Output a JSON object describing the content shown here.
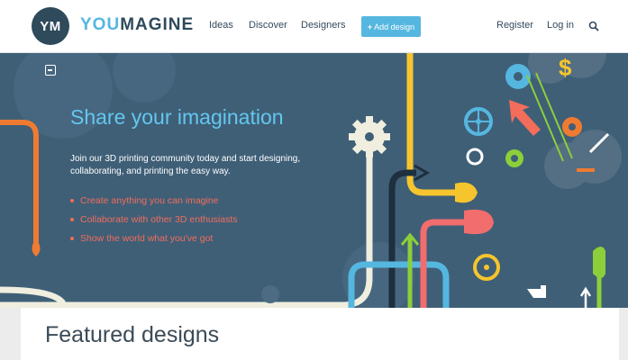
{
  "header": {
    "logo_badge": "YM",
    "logo_you": "YOU",
    "logo_magine": "MAGINE",
    "nav": [
      "Ideas",
      "Discover",
      "Designers"
    ],
    "add_button_plus": "+",
    "add_button_label": "Add design",
    "register": "Register",
    "login": "Log in",
    "search_icon": "search-icon"
  },
  "hero": {
    "title": "Share your imagination",
    "subtitle": "Join our 3D printing community today and start designing, collaborating, and printing the easy way.",
    "bullets": [
      "Create anything you can imagine",
      "Collaborate with other 3D enthusiasts",
      "Show the world what you've got"
    ],
    "collapse_icon": "collapse-icon"
  },
  "featured": {
    "title": "Featured designs"
  },
  "colors": {
    "brand_dark": "#2e4a5b",
    "brand_light": "#55b7e0",
    "hero_bg": "#3f5f77",
    "accent_red": "#f26d5b"
  }
}
